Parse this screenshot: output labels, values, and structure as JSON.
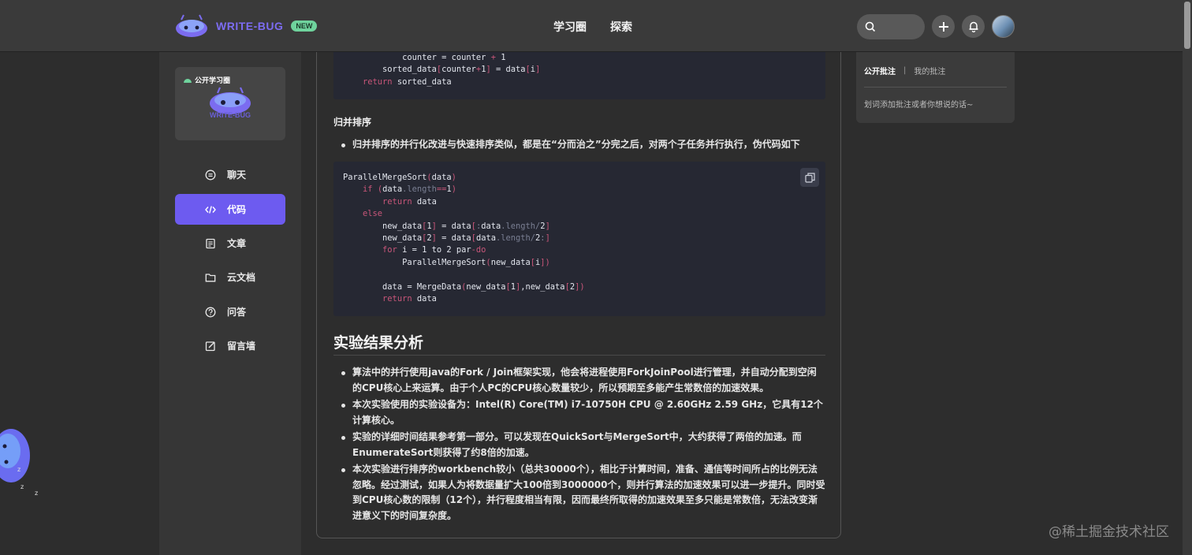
{
  "header": {
    "brand": "WRITE-BUG",
    "badge": "NEW",
    "nav": [
      "学习圈",
      "探索"
    ]
  },
  "sidebar": {
    "card_tag": "公开学习圈",
    "card_brand": "WRITE-BUG",
    "items": [
      {
        "label": "聊天",
        "icon": "chat-icon"
      },
      {
        "label": "代码",
        "icon": "code-icon",
        "active": true
      },
      {
        "label": "文章",
        "icon": "article-icon"
      },
      {
        "label": "云文档",
        "icon": "folder-icon"
      },
      {
        "label": "问答",
        "icon": "question-icon"
      },
      {
        "label": "留言墙",
        "icon": "edit-icon"
      }
    ]
  },
  "article": {
    "code1": [
      "            counter = counter + 1",
      "        sorted_data[counter+1] = data[i]",
      "    return sorted_data"
    ],
    "merge_heading": "归并排序",
    "merge_bullet": "归并排序的并行化改进与快速排序类似，都是在“分而治之”分完之后，对两个子任务并行执行，伪代码如下",
    "code2": [
      "ParallelMergeSort(data)",
      "    if (data.length==1)",
      "        return data",
      "    else",
      "        new_data[1] = data[:data.length/2]",
      "        new_data[2] = data[data.length/2:]",
      "        for i = 1 to 2 par-do",
      "            ParallelMergeSort(new_data[i])",
      "",
      "        data = MergeData(new_data[1],new_data[2])",
      "        return data"
    ],
    "results_heading": "实验结果分析",
    "bullets": [
      "算法中的并行使用java的Fork / Join框架实现，他会将进程使用ForkJoinPool进行管理，并自动分配到空闲的CPU核心上来运算。由于个人PC的CPU核心数量较少，所以预期至多能产生常数倍的加速效果。",
      "本次实验使用的实验设备为：Intel(R) Core(TM) i7-10750H CPU @ 2.60GHz 2.59 GHz，它具有12个计算核心。",
      "实验的详细时间结果参考第一部分。可以发现在QuickSort与MergeSort中，大约获得了两倍的加速。而EnumerateSort则获得了约8倍的加速。",
      "本次实验进行排序的workbench较小（总共30000个），相比于计算时间，准备、通信等时间所占的比例无法忽略。经过测试，如果人为将数据量扩大100倍到3000000个，则并行算法的加速效果可以进一步提升。同时受到CPU核心数的限制（12个），并行程度相当有限，因而最终所取得的加速效果至多只能是常数倍，无法改变渐进意义下的时间复杂度。"
    ]
  },
  "annotations": {
    "tab_public": "公开批注",
    "separator": "|",
    "tab_mine": "我的批注",
    "hint": "划词添加批注或者你想说的话~"
  },
  "watermark": "@稀土掘金技术社区",
  "colors": {
    "accent": "#6d5bf0",
    "new_badge": "#6fd39d",
    "code_keyword": "#c9567a"
  }
}
